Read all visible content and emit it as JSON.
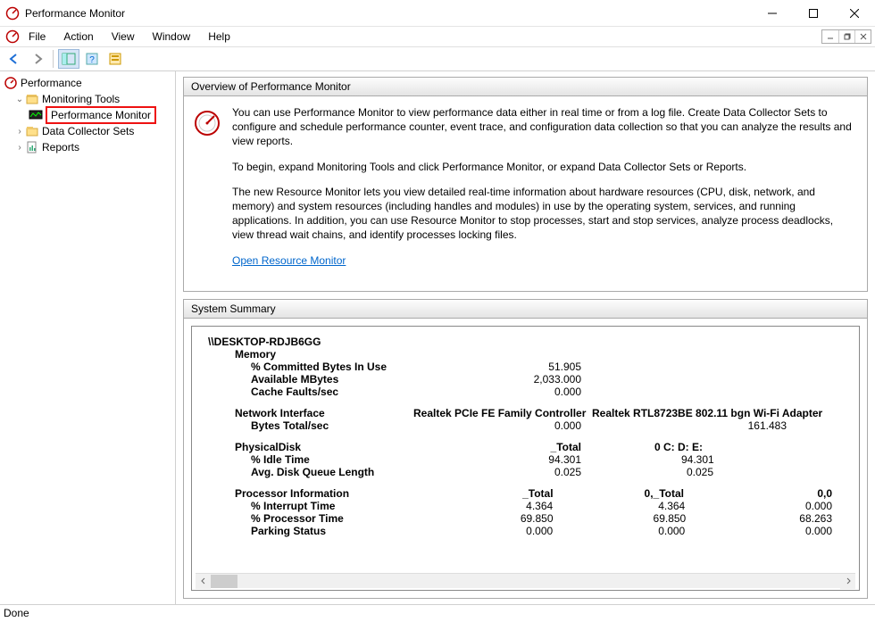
{
  "window": {
    "title": "Performance Monitor"
  },
  "menu": {
    "file": "File",
    "action": "Action",
    "view": "View",
    "window": "Window",
    "help": "Help"
  },
  "tree": {
    "root": "Performance",
    "monitoring_tools": "Monitoring Tools",
    "performance_monitor": "Performance Monitor",
    "data_collector_sets": "Data Collector Sets",
    "reports": "Reports"
  },
  "overview": {
    "title": "Overview of Performance Monitor",
    "p1": "You can use Performance Monitor to view performance data either in real time or from a log file. Create Data Collector Sets to configure and schedule performance counter, event trace, and configuration data collection so that you can analyze the results and view reports.",
    "p2": "To begin, expand Monitoring Tools and click Performance Monitor, or expand Data Collector Sets or Reports.",
    "p3": "The new Resource Monitor lets you view detailed real-time information about hardware resources (CPU, disk, network, and memory) and system resources (including handles and modules) in use by the operating system, services, and running applications. In addition, you can use Resource Monitor to stop processes, start and stop services, analyze process deadlocks, view thread wait chains, and identify processes locking files.",
    "link": "Open Resource Monitor"
  },
  "summary": {
    "title": "System Summary",
    "host": "\\\\DESKTOP-RDJB6GG",
    "memory": {
      "label": "Memory",
      "committed_label": "% Committed Bytes In Use",
      "committed_value": "51.905",
      "available_label": "Available MBytes",
      "available_value": "2,033.000",
      "cachefaults_label": "Cache Faults/sec",
      "cachefaults_value": "0.000"
    },
    "network": {
      "label": "Network Interface",
      "col1": "Realtek PCIe FE Family Controller",
      "col2": "Realtek RTL8723BE 802.11 bgn Wi-Fi Adapter",
      "bytes_label": "Bytes Total/sec",
      "bytes_v1": "0.000",
      "bytes_v2": "161.483"
    },
    "disk": {
      "label": "PhysicalDisk",
      "col1": "_Total",
      "col2": "0 C: D: E:",
      "idle_label": "% Idle Time",
      "idle_v1": "94.301",
      "idle_v2": "94.301",
      "queue_label": "Avg. Disk Queue Length",
      "queue_v1": "0.025",
      "queue_v2": "0.025"
    },
    "proc": {
      "label": "Processor Information",
      "col1": "_Total",
      "col2": "0,_Total",
      "col3": "0,0",
      "interrupt_label": "% Interrupt Time",
      "interrupt_v1": "4.364",
      "interrupt_v2": "4.364",
      "interrupt_v3": "0.000",
      "proctime_label": "% Processor Time",
      "proctime_v1": "69.850",
      "proctime_v2": "69.850",
      "proctime_v3": "68.263",
      "parking_label": "Parking Status",
      "parking_v1": "0.000",
      "parking_v2": "0.000",
      "parking_v3": "0.000"
    }
  },
  "status": "Done"
}
